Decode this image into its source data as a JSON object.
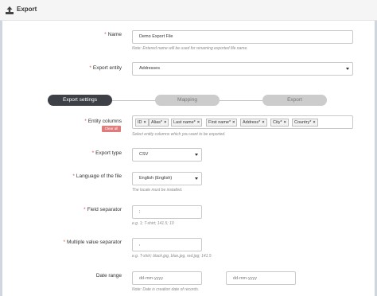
{
  "header": {
    "title": "Export"
  },
  "form": {
    "name": {
      "label": "Name",
      "value": "Demo Export File",
      "note": "Note: Entered name will be used for renaming exported file name."
    },
    "entity": {
      "label": "Export entity",
      "value": "Addresses"
    },
    "steps": [
      "Export settings",
      "Mapping",
      "Export"
    ],
    "entity_columns": {
      "label": "Entity columns",
      "clear_label": "Clear all",
      "tags": [
        "ID",
        "Alias*",
        "Last name*",
        "First name*",
        "Address*",
        "City*",
        "Country*"
      ],
      "note": "Select entity columns which you want to be exported."
    },
    "export_type": {
      "label": "Export type",
      "value": "CSV"
    },
    "language": {
      "label": "Language of the file",
      "value": "English (English)",
      "note": "The locale must be installed."
    },
    "field_separator": {
      "label": "Field separator",
      "value": ";",
      "note": "e.g. 1; T-shirt; 141.5; 10"
    },
    "multi_separator": {
      "label": "Multiple value separator",
      "value": ",",
      "note": "e.g. T-shirt; black.jpg, blue.jpg, red.jpg; 141.5"
    },
    "date_range": {
      "label": "Date range",
      "from_placeholder": "dd-mm-yyyy",
      "to_placeholder": "dd-mm-yyyy",
      "note": "Note: Date is creation date of records."
    }
  }
}
